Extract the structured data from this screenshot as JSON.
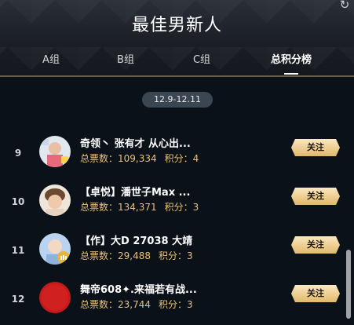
{
  "header": {
    "title": "最佳男新人",
    "refresh_icon": "refresh-icon"
  },
  "tabs": [
    {
      "label": "A组",
      "active": false
    },
    {
      "label": "B组",
      "active": false
    },
    {
      "label": "C组",
      "active": false
    },
    {
      "label": "总积分榜",
      "active": true
    }
  ],
  "date_range": "12.9-12.11",
  "rows": [
    {
      "rank": "9",
      "name": "奇领丶 张有才 从心出...",
      "votes_text": "总票数：109,334",
      "score_text": "积分：4",
      "follow": "关注"
    },
    {
      "rank": "10",
      "name": "【卓悦】潘世子Max ...",
      "votes_text": "总票数：134,371",
      "score_text": "积分：3",
      "follow": "关注"
    },
    {
      "rank": "11",
      "name": "【作】大D 27038 大靖",
      "votes_text": "总票数：29,488",
      "score_text": "积分：3",
      "follow": "关注"
    },
    {
      "rank": "12",
      "name": "舞帝608✦.来福若有战...",
      "votes_text": "总票数：23,744",
      "score_text": "积分：3",
      "follow": "关注"
    }
  ],
  "colors": {
    "gold_text": "#e7c07a",
    "follow_button": "#f1d49c",
    "background": "#0b1118"
  }
}
